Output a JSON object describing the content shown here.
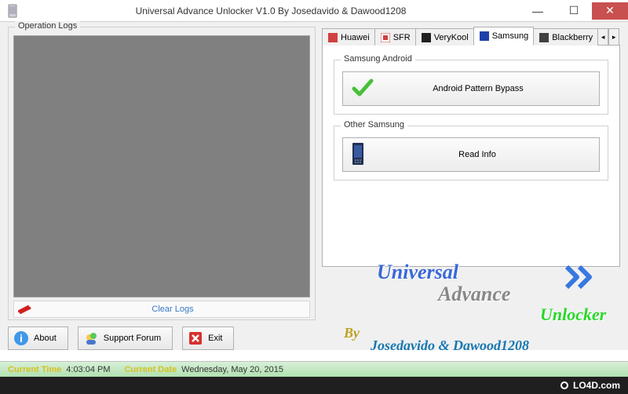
{
  "window": {
    "title": "Universal Advance Unlocker V1.0 By Josedavido & Dawood1208"
  },
  "logs": {
    "group_label": "Operation Logs",
    "clear_label": "Clear Logs"
  },
  "buttons": {
    "about": "About",
    "support": "Support Forum",
    "exit": "Exit"
  },
  "tabs": [
    {
      "label": "Huawei",
      "active": false
    },
    {
      "label": "SFR",
      "active": false
    },
    {
      "label": "VeryKool",
      "active": false
    },
    {
      "label": "Samsung",
      "active": true
    },
    {
      "label": "Blackberry",
      "active": false
    }
  ],
  "sections": {
    "samsung_android": {
      "label": "Samsung Android",
      "button": "Android Pattern Bypass"
    },
    "other_samsung": {
      "label": "Other Samsung",
      "button": "Read Info"
    }
  },
  "branding": {
    "line1": "Universal",
    "line2": "Advance",
    "line3": "Unlocker",
    "by": "By",
    "credits": "Josedavido & Dawood1208"
  },
  "status": {
    "time_label": "Current Time",
    "time_value": "4:03:04 PM",
    "date_label": "Current Date",
    "date_value": "Wednesday, May 20, 2015"
  },
  "watermark": "LO4D.com"
}
